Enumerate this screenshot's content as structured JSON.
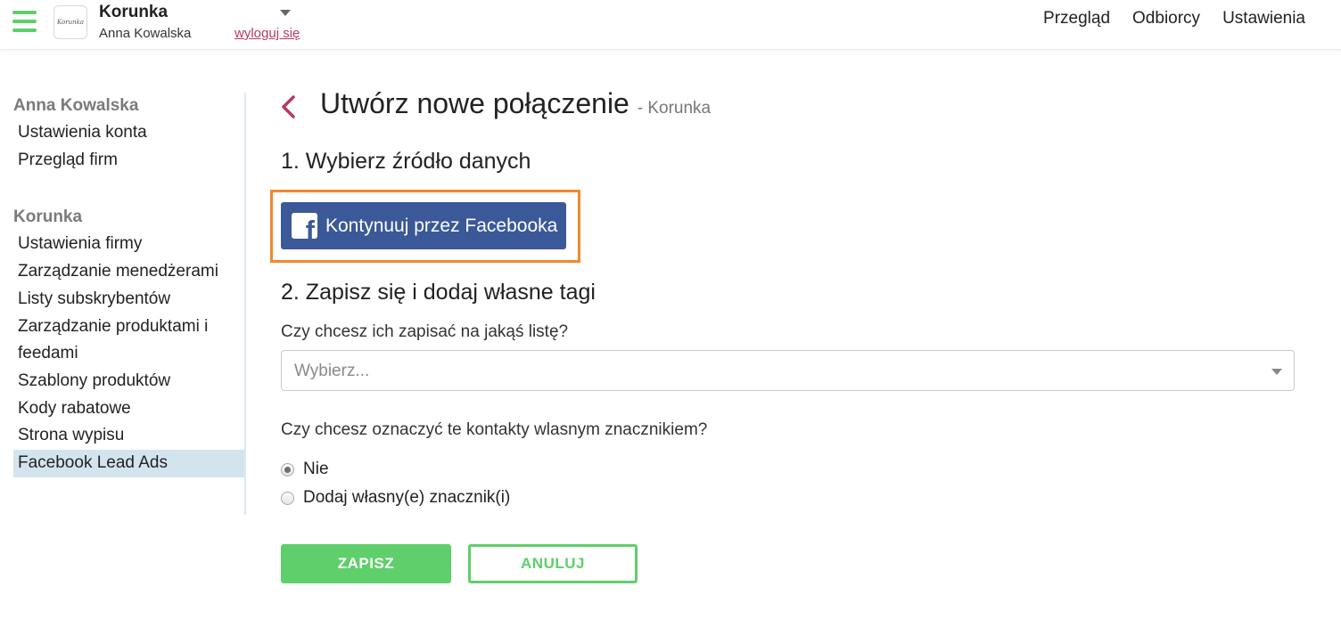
{
  "header": {
    "logo_text": "Korunka",
    "company_name": "Korunka",
    "user_name": "Anna Kowalska",
    "logout_label": "wyloguj się",
    "nav": [
      "Przegląd",
      "Odbiorcy",
      "Ustawienia"
    ]
  },
  "sidebar": {
    "account_section_title": "Anna Kowalska",
    "account_items": [
      "Ustawienia konta",
      "Przegląd firm"
    ],
    "company_section_title": "Korunka",
    "company_items": [
      "Ustawienia firmy",
      "Zarządzanie menedżerami",
      "Listy subskrybentów",
      "Zarządzanie produktami i",
      "feedami",
      "Szablony produktów",
      "Kody rabatowe",
      "Strona wypisu",
      "Facebook Lead Ads"
    ],
    "active_item": "Facebook Lead Ads"
  },
  "main": {
    "title": "Utwórz nowe połączenie",
    "subtitle": "- Korunka",
    "step1_heading": "1. Wybierz źródło danych",
    "facebook_button_label": "Kontynuuj przez Facebooka",
    "step2_heading": "2. Zapisz się i dodaj własne tagi",
    "list_question": "Czy chcesz ich zapisać na jakąś listę?",
    "list_select_placeholder": "Wybierz...",
    "tag_question": "Czy chcesz oznaczyć te kontakty wlasnym znacznikiem?",
    "radio_options": [
      "Nie",
      "Dodaj własny(e) znacznik(i)"
    ],
    "radio_selected": "Nie",
    "save_label": "ZAPISZ",
    "cancel_label": "ANULUJ"
  },
  "colors": {
    "accent_green": "#5fcf6b",
    "facebook_blue": "#3b5998",
    "highlight_orange": "#f08a2c",
    "link_red": "#b63a5e",
    "sidebar_active_bg": "#d4e4ef"
  },
  "icons": [
    "hamburger-menu-icon",
    "chevron-down-icon",
    "chevron-left-icon",
    "facebook-icon"
  ]
}
